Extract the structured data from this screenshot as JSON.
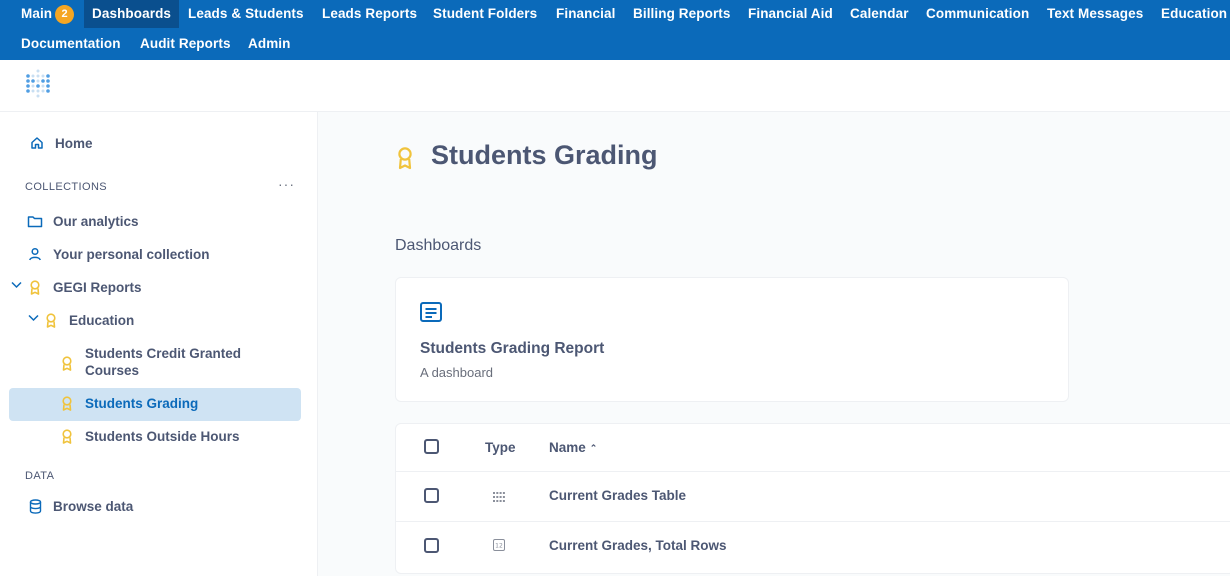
{
  "topnav": {
    "items": [
      {
        "label": "Main",
        "badge": "2"
      },
      {
        "label": "Dashboards"
      },
      {
        "label": "Leads & Students"
      },
      {
        "label": "Leads Reports"
      },
      {
        "label": "Student Folders"
      },
      {
        "label": "Financial"
      },
      {
        "label": "Billing Reports"
      },
      {
        "label": "Financial Aid"
      },
      {
        "label": "Calendar"
      },
      {
        "label": "Communication"
      },
      {
        "label": "Text Messages"
      },
      {
        "label": "Education"
      },
      {
        "label": "Documentation"
      },
      {
        "label": "Audit Reports"
      },
      {
        "label": "Admin"
      }
    ],
    "active": "Dashboards"
  },
  "sidebar": {
    "home": "Home",
    "collections_heading": "COLLECTIONS",
    "collections": [
      {
        "label": "Our analytics",
        "icon": "folder-icon"
      },
      {
        "label": "Your personal collection",
        "icon": "person-icon"
      },
      {
        "label": "GEGI Reports",
        "icon": "badge-icon"
      },
      {
        "label": "Education",
        "icon": "badge-icon"
      },
      {
        "label": "Students Credit Granted Courses",
        "icon": "badge-icon"
      },
      {
        "label": "Students Grading",
        "icon": "badge-icon",
        "selected": true
      },
      {
        "label": "Students Outside Hours",
        "icon": "badge-icon"
      }
    ],
    "data_heading": "DATA",
    "browse": "Browse data"
  },
  "main": {
    "title": "Students Grading",
    "dashboards_label": "Dashboards",
    "card": {
      "title": "Students Grading Report",
      "description": "A dashboard"
    },
    "table": {
      "headers": {
        "type": "Type",
        "name": "Name"
      },
      "rows": [
        {
          "name": "Current Grades Table",
          "type_icon": "grid-icon"
        },
        {
          "name": "Current Grades, Total Rows",
          "type_icon": "number-icon"
        }
      ]
    }
  },
  "colors": {
    "nav": "#0b6aba",
    "accent": "#509ee3",
    "badge": "#f5a623",
    "gold": "#f0c33c"
  }
}
